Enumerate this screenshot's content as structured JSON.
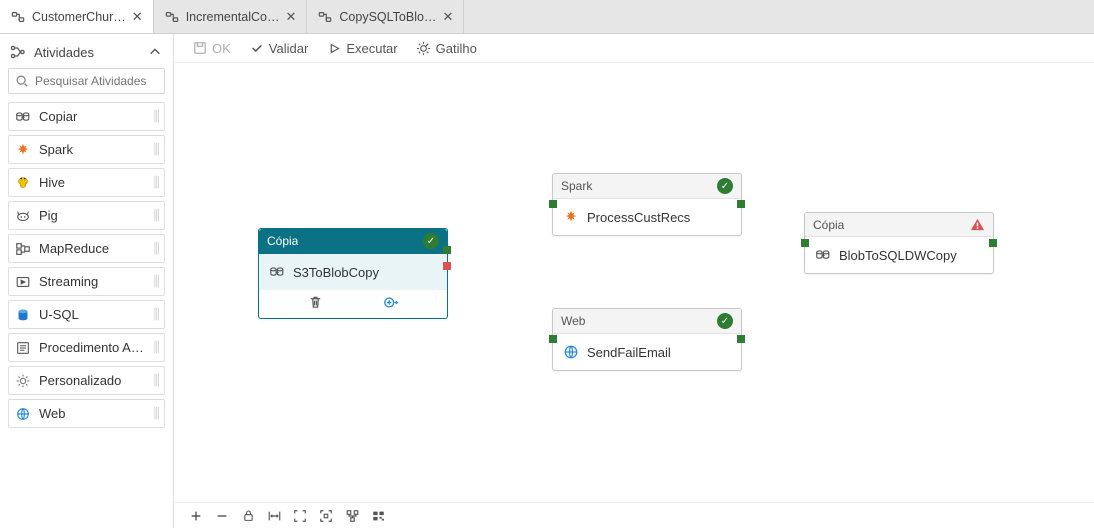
{
  "tabs": [
    {
      "label": "CustomerChur…"
    },
    {
      "label": "IncrementalCo…"
    },
    {
      "label": "CopySQLToBlo…"
    }
  ],
  "sidebar": {
    "title": "Atividades",
    "search_placeholder": "Pesquisar Atividades",
    "items": [
      {
        "label": "Copiar"
      },
      {
        "label": "Spark"
      },
      {
        "label": "Hive"
      },
      {
        "label": "Pig"
      },
      {
        "label": "MapReduce"
      },
      {
        "label": "Streaming"
      },
      {
        "label": "U-SQL"
      },
      {
        "label": "Procedimento A…"
      },
      {
        "label": "Personalizado"
      },
      {
        "label": "Web"
      }
    ]
  },
  "toolbar": {
    "ok": "OK",
    "validate": "Validar",
    "run": "Executar",
    "trigger": "Gatilho"
  },
  "nodes": {
    "copy1": {
      "type": "Cópia",
      "name": "S3ToBlobCopy",
      "status": "ok",
      "selected": true
    },
    "spark": {
      "type": "Spark",
      "name": "ProcessCustRecs",
      "status": "ok"
    },
    "web": {
      "type": "Web",
      "name": "SendFailEmail",
      "status": "ok"
    },
    "copy2": {
      "type": "Cópia",
      "name": "BlobToSQLDWCopy",
      "status": "warn"
    }
  }
}
